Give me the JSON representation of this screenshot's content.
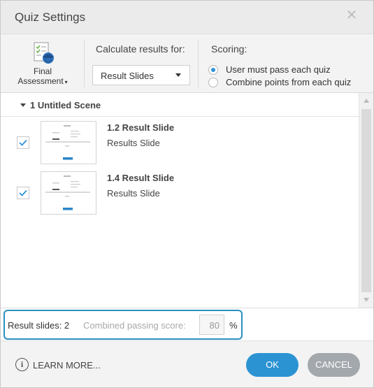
{
  "dialog": {
    "title": "Quiz Settings",
    "close_icon": "close-icon"
  },
  "toolbar": {
    "assessment_label_line1": "Final",
    "assessment_label_line2": "Assessment",
    "assessment_caret": "▾",
    "calculate_label": "Calculate results for:",
    "calculate_selected": "Result Slides",
    "scoring_label": "Scoring:",
    "scoring_options": [
      {
        "label": "User must pass each quiz",
        "selected": true
      },
      {
        "label": "Combine points from each quiz",
        "selected": false
      }
    ]
  },
  "list": {
    "scene_name": "1 Untitled Scene",
    "items": [
      {
        "title": "1.2 Result Slide",
        "subtitle": "Results Slide",
        "checked": true
      },
      {
        "title": "1.4 Result Slide",
        "subtitle": "Results Slide",
        "checked": true
      }
    ]
  },
  "summary": {
    "result_slides_text": "Result slides: 2",
    "combined_label": "Combined passing score:",
    "combined_value": "80",
    "percent_sign": "%"
  },
  "footer": {
    "learn_more": "LEARN MORE...",
    "info_glyph": "i",
    "ok_label": "OK",
    "cancel_label": "CANCEL"
  },
  "colors": {
    "accent": "#2c93d3",
    "highlight_border": "#2a8fc2",
    "cancel_button": "#a3a8ad"
  }
}
